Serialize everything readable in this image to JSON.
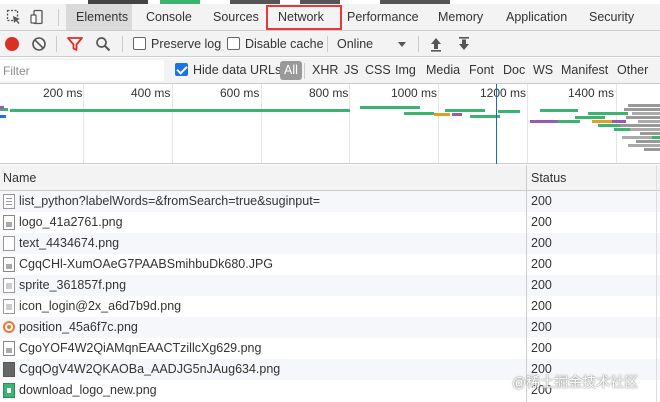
{
  "tabs": [
    {
      "label": "Elements",
      "active": true
    },
    {
      "label": "Console"
    },
    {
      "label": "Sources"
    },
    {
      "label": "Network",
      "highlighted": true
    },
    {
      "label": "Performance"
    },
    {
      "label": "Memory"
    },
    {
      "label": "Application"
    },
    {
      "label": "Security"
    }
  ],
  "toolbar": {
    "preserve_log": "Preserve log",
    "disable_cache": "Disable cache",
    "throttle": "Online"
  },
  "filter": {
    "placeholder": "Filter",
    "hide_data_urls": "Hide data URLs",
    "hide_data_urls_checked": true,
    "types": [
      "All",
      "XHR",
      "JS",
      "CSS",
      "Img",
      "Media",
      "Font",
      "Doc",
      "WS",
      "Manifest",
      "Other"
    ]
  },
  "overview": {
    "ticks": [
      "200 ms",
      "400 ms",
      "600 ms",
      "800 ms",
      "1000 ms",
      "1200 ms",
      "1400 ms"
    ]
  },
  "table": {
    "headers": {
      "name": "Name",
      "status": "Status"
    },
    "rows": [
      {
        "name": "list_python?labelWords=&fromSearch=true&suginput=",
        "status": "200",
        "icon": "doc"
      },
      {
        "name": "logo_41a2761.png",
        "status": "200",
        "icon": "img"
      },
      {
        "name": "text_4434674.png",
        "status": "200",
        "icon": "plain"
      },
      {
        "name": "CgqCHl-XumOAeG7PAABSmihbuDk680.JPG",
        "status": "200",
        "icon": "img"
      },
      {
        "name": "sprite_361857f.png",
        "status": "200",
        "icon": "gray"
      },
      {
        "name": "icon_login@2x_a6d7b9d.png",
        "status": "200",
        "icon": "gray"
      },
      {
        "name": "position_45a6f7c.png",
        "status": "200",
        "icon": "orange"
      },
      {
        "name": "CgoYOF4W2QiAMqnEAACTzillcXg629.png",
        "status": "200",
        "icon": "img"
      },
      {
        "name": "CgqOgV4W2QKAOBa_AADJG5nJAug634.png",
        "status": "200",
        "icon": "dark"
      },
      {
        "name": "download_logo_new.png",
        "status": "200",
        "icon": "green"
      }
    ]
  },
  "watermark": "@稀土掘金技术社区",
  "colors": {
    "record": "#d93025",
    "accent": "#1a73e8",
    "highlight_box": "#e53935",
    "filter_icon": "#d93025"
  }
}
